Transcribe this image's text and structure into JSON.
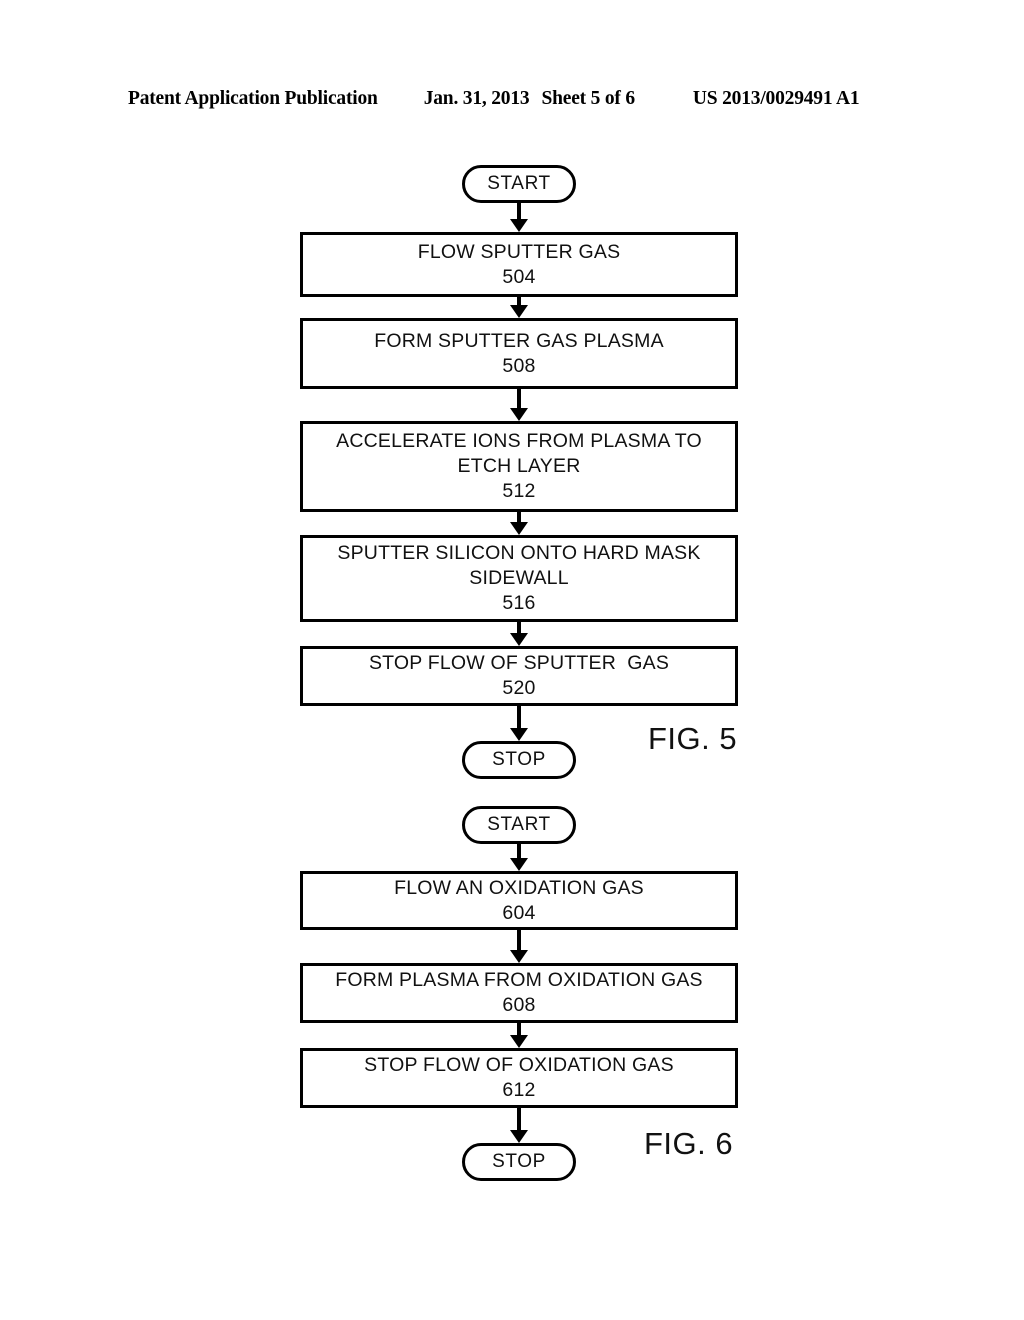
{
  "header": {
    "publication": "Patent Application Publication",
    "date": "Jan. 31, 2013",
    "sheet": "Sheet 5 of 6",
    "document_number": "US 2013/0029491 A1"
  },
  "figures": [
    {
      "caption": "FIG. 5",
      "nodes": [
        {
          "type": "terminator",
          "label": "START"
        },
        {
          "type": "process",
          "label": "FLOW SPUTTER GAS",
          "ref": "504"
        },
        {
          "type": "process",
          "label": "FORM SPUTTER GAS PLASMA",
          "ref": "508"
        },
        {
          "type": "process",
          "label": "ACCELERATE IONS FROM PLASMA TO ETCH LAYER",
          "ref": "512"
        },
        {
          "type": "process",
          "label": "SPUTTER SILICON ONTO HARD MASK SIDEWALL",
          "ref": "516"
        },
        {
          "type": "process",
          "label": "STOP FLOW OF SPUTTER  GAS",
          "ref": "520"
        },
        {
          "type": "terminator",
          "label": "STOP"
        }
      ]
    },
    {
      "caption": "FIG. 6",
      "nodes": [
        {
          "type": "terminator",
          "label": "START"
        },
        {
          "type": "process",
          "label": "FLOW AN OXIDATION GAS",
          "ref": "604"
        },
        {
          "type": "process",
          "label": "FORM PLASMA FROM OXIDATION GAS",
          "ref": "608"
        },
        {
          "type": "process",
          "label": "STOP FLOW OF OXIDATION GAS",
          "ref": "612"
        },
        {
          "type": "terminator",
          "label": "STOP"
        }
      ]
    }
  ]
}
